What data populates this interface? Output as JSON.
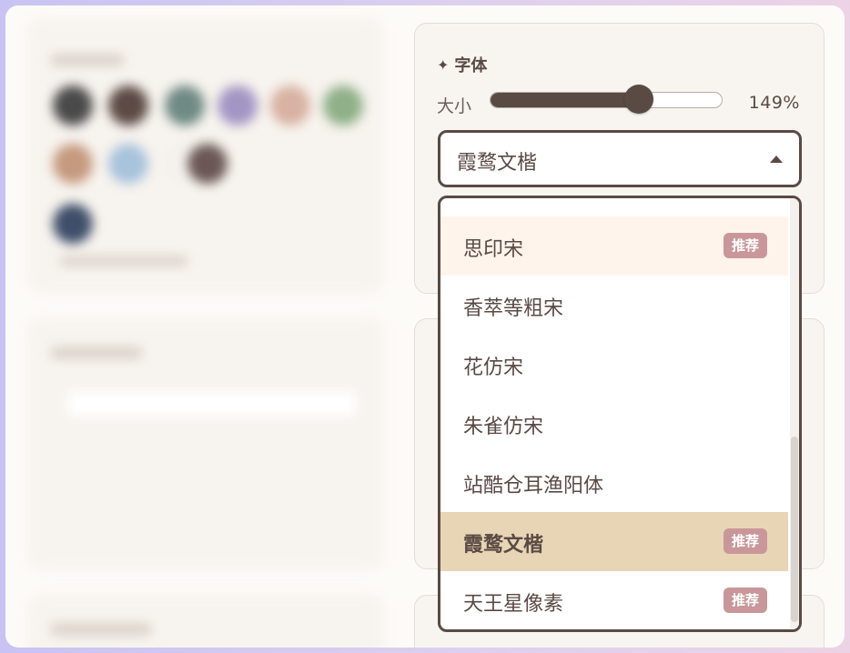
{
  "font_panel": {
    "title": "字体",
    "title_icon": "sparkle-icon",
    "size_label": "大小",
    "size_value": "149%",
    "size_fraction": 0.64,
    "selected_font": "霞鹜文楷"
  },
  "font_options": [
    {
      "label": "思印宋",
      "badge": "推荐",
      "state": "hovered"
    },
    {
      "label": "香萃等粗宋",
      "badge": "",
      "state": ""
    },
    {
      "label": "花仿宋",
      "badge": "",
      "state": ""
    },
    {
      "label": "朱雀仿宋",
      "badge": "",
      "state": ""
    },
    {
      "label": "站酷仓耳渔阳体",
      "badge": "",
      "state": ""
    },
    {
      "label": "霞鹜文楷",
      "badge": "推荐",
      "state": "selected"
    },
    {
      "label": "天王星像素",
      "badge": "推荐",
      "state": ""
    }
  ],
  "colors": {
    "accent": "#5a4a44",
    "selected_bg": "#e8d5b5",
    "hover_bg": "#fff4ec",
    "badge_bg": "#c9979a"
  },
  "blurred_swatches": [
    "#4a4a4a",
    "#5d4a45",
    "#6f8a84",
    "#a496c4",
    "#d8b2a2",
    "#8fb088",
    "#c59a7e",
    "#a8c3dc",
    "#f4f1ee",
    "#6b5855",
    "#3f4f6a"
  ]
}
